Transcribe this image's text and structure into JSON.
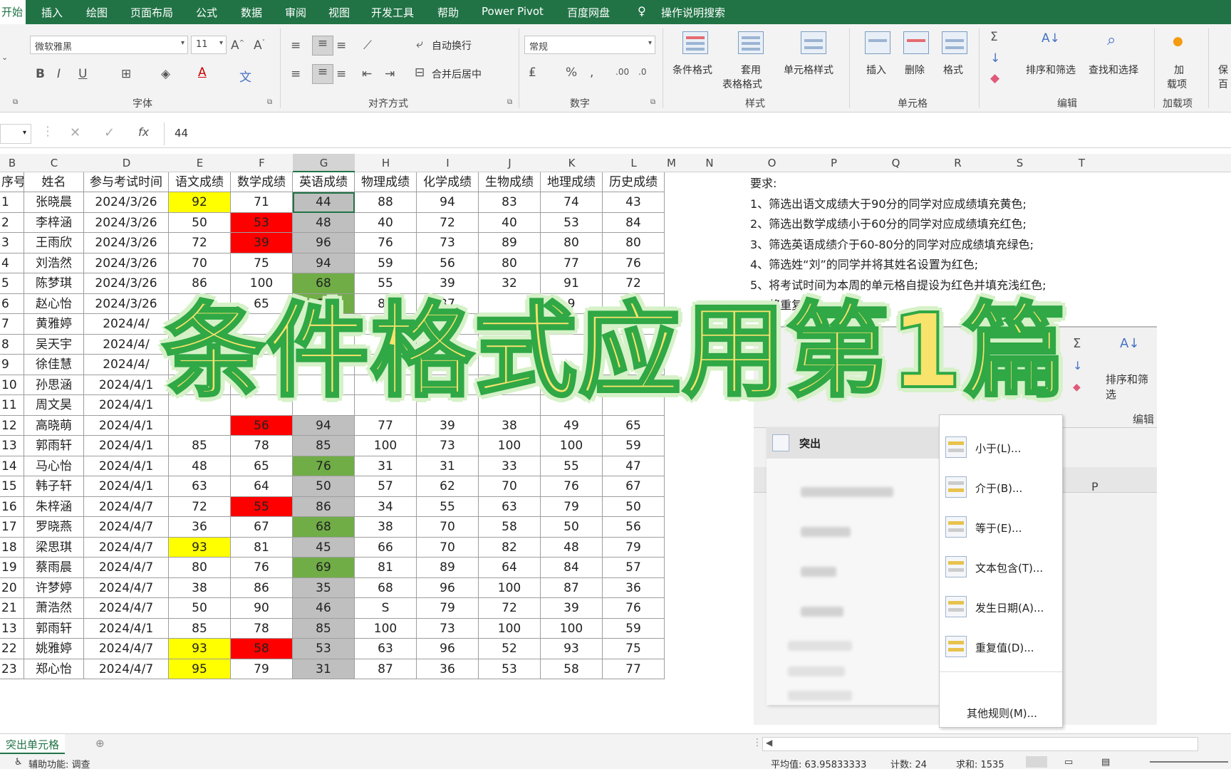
{
  "menu": {
    "tabs": [
      "开始",
      "插入",
      "绘图",
      "页面布局",
      "公式",
      "数据",
      "审阅",
      "视图",
      "开发工具",
      "帮助",
      "Power Pivot",
      "百度网盘"
    ],
    "tell_me": "操作说明搜索"
  },
  "ribbon": {
    "font_name": "微软雅黑",
    "font_size": "11",
    "font_group": "字体",
    "wrap_text": "自动换行",
    "merge_center": "合并后居中",
    "align_group": "对齐方式",
    "number_format": "常规",
    "number_group": "数字",
    "cond_format": "条件格式",
    "table_format_1": "套用",
    "table_format_2": "表格格式",
    "cell_style": "单元格样式",
    "styles_group": "样式",
    "insert": "插入",
    "delete": "删除",
    "format": "格式",
    "cells_group": "单元格",
    "sort_filter": "排序和筛选",
    "find_select": "查找和选择",
    "edit_group": "编辑",
    "addin_1": "加",
    "addin_2": "载项",
    "addin_group": "加载项",
    "save_1": "保",
    "save_2": "百"
  },
  "formula_bar": {
    "fx": "fx",
    "value": "44"
  },
  "columns": [
    "B",
    "C",
    "D",
    "E",
    "F",
    "G",
    "H",
    "I",
    "J",
    "K",
    "L",
    "M",
    "N",
    "O",
    "P",
    "Q",
    "R",
    "S",
    "T"
  ],
  "table": {
    "headers": [
      "序号",
      "姓名",
      "参与考试时间",
      "语文成绩",
      "数学成绩",
      "英语成绩",
      "物理成绩",
      "化学成绩",
      "生物成绩",
      "地理成绩",
      "历史成绩"
    ],
    "rows": [
      [
        "1",
        "张晓晨",
        "2024/3/26",
        "92",
        "71",
        "44",
        "88",
        "94",
        "83",
        "74",
        "43"
      ],
      [
        "2",
        "李梓涵",
        "2024/3/26",
        "50",
        "53",
        "48",
        "40",
        "72",
        "40",
        "53",
        "84"
      ],
      [
        "3",
        "王雨欣",
        "2024/3/26",
        "72",
        "39",
        "96",
        "76",
        "73",
        "89",
        "80",
        "80"
      ],
      [
        "4",
        "刘浩然",
        "2024/3/26",
        "70",
        "75",
        "94",
        "59",
        "56",
        "80",
        "77",
        "76"
      ],
      [
        "5",
        "陈梦琪",
        "2024/3/26",
        "86",
        "100",
        "68",
        "55",
        "39",
        "32",
        "91",
        "72"
      ],
      [
        "6",
        "赵心怡",
        "2024/3/26",
        "",
        "65",
        "69",
        "87",
        "37",
        "",
        "9",
        "5"
      ],
      [
        "7",
        "黄雅婷",
        "2024/4/",
        "",
        "",
        "",
        "",
        "",
        "",
        "",
        ""
      ],
      [
        "8",
        "吴天宇",
        "2024/4/",
        "",
        "",
        "",
        "",
        "",
        "",
        "",
        ""
      ],
      [
        "9",
        "徐佳慧",
        "2024/4/",
        "",
        "",
        "",
        "",
        "",
        "",
        "",
        ""
      ],
      [
        "10",
        "孙思涵",
        "2024/4/1",
        "",
        "",
        "",
        "",
        "",
        "",
        "",
        ""
      ],
      [
        "11",
        "周文昊",
        "2024/4/1",
        "",
        "",
        "",
        "",
        "",
        "",
        "",
        ""
      ],
      [
        "12",
        "高晓萌",
        "2024/4/1",
        "",
        "56",
        "94",
        "77",
        "39",
        "38",
        "49",
        "65"
      ],
      [
        "13",
        "郭雨轩",
        "2024/4/1",
        "85",
        "78",
        "85",
        "100",
        "73",
        "100",
        "100",
        "59"
      ],
      [
        "14",
        "马心怡",
        "2024/4/1",
        "48",
        "65",
        "76",
        "31",
        "31",
        "33",
        "55",
        "47"
      ],
      [
        "15",
        "韩子轩",
        "2024/4/1",
        "63",
        "64",
        "50",
        "57",
        "62",
        "70",
        "76",
        "67"
      ],
      [
        "16",
        "朱梓涵",
        "2024/4/7",
        "72",
        "55",
        "86",
        "34",
        "55",
        "63",
        "79",
        "50"
      ],
      [
        "17",
        "罗晓燕",
        "2024/4/7",
        "36",
        "67",
        "68",
        "38",
        "70",
        "58",
        "50",
        "56"
      ],
      [
        "18",
        "梁思琪",
        "2024/4/7",
        "93",
        "81",
        "45",
        "66",
        "70",
        "82",
        "48",
        "79"
      ],
      [
        "19",
        "蔡雨晨",
        "2024/4/7",
        "80",
        "76",
        "69",
        "81",
        "89",
        "64",
        "84",
        "57"
      ],
      [
        "20",
        "许梦婷",
        "2024/4/7",
        "38",
        "86",
        "35",
        "68",
        "96",
        "100",
        "87",
        "36"
      ],
      [
        "21",
        "萧浩然",
        "2024/4/7",
        "50",
        "90",
        "46",
        "S",
        "79",
        "72",
        "39",
        "76"
      ],
      [
        "13",
        "郭雨轩",
        "2024/4/1",
        "85",
        "78",
        "85",
        "100",
        "73",
        "100",
        "100",
        "59"
      ],
      [
        "22",
        "姚雅婷",
        "2024/4/7",
        "93",
        "58",
        "53",
        "63",
        "96",
        "52",
        "93",
        "75"
      ],
      [
        "23",
        "郑心怡",
        "2024/4/7",
        "95",
        "79",
        "31",
        "87",
        "36",
        "53",
        "58",
        "77"
      ]
    ]
  },
  "highlights": {
    "yellow": "#ffff00",
    "red": "#ff0000",
    "green": "#70ad47",
    "gray": "#bfbfbf"
  },
  "requirements": [
    "要求:",
    "1、筛选出语文成绩大于90分的同学对应成绩填充黄色;",
    "2、筛选出数学成绩小于60分的同学对应成绩填充红色;",
    "3、筛选英语成绩介于60-80分的同学对应成绩填充绿色;",
    "4、筛选姓“刘”的同学并将其姓名设置为红色;",
    "5、将考试时间为本周的单元格自提设为红色并填充浅红色;",
    "6、将重复的"
  ],
  "overlay": {
    "big_title": "条件格式应用第1篇",
    "highlight_rules": "突出",
    "sort_filter": "排序和筛选",
    "edit_group": "编辑",
    "col_p": "P",
    "submenu": [
      "小于(L)...",
      "介于(B)...",
      "等于(E)...",
      "文本包含(T)...",
      "发生日期(A)...",
      "重复值(D)...",
      "其他规则(M)..."
    ]
  },
  "sheet": {
    "tab": "突出单元格"
  },
  "status": {
    "accessibility": "辅助功能: 调查",
    "average": "平均值: 63.95833333",
    "count": "计数: 24",
    "sum": "求和: 1535"
  }
}
